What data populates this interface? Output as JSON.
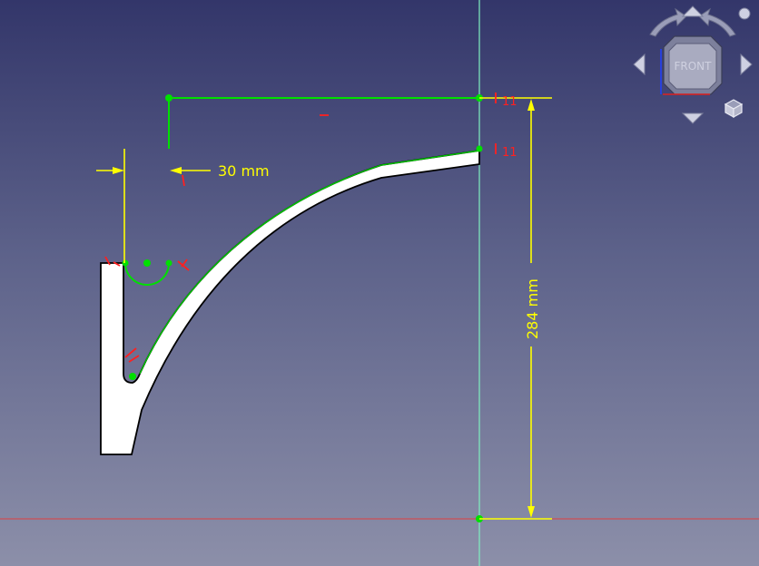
{
  "view": {
    "name": "Sketch 3D view",
    "colors": {
      "background_top": "#33366a",
      "background_bottom": "#8c8fa9",
      "constraint_green": "#00e000",
      "dimension_yellow": "#ffff00",
      "constraint_red": "#ff2020",
      "axis_vertical": "#7ff0c0",
      "axis_horizontal": "#e04040"
    }
  },
  "sketch": {
    "dimension_horizontal": "30 mm",
    "dimension_vertical": "284 mm",
    "constraint_top_label": "11",
    "constraint_mid_label": "11"
  },
  "navigation_cube": {
    "face_label": "FRONT",
    "icons": [
      "rotate-left-icon",
      "rotate-right-icon",
      "arrow-up-icon",
      "arrow-down-icon",
      "arrow-left-icon",
      "arrow-right-icon",
      "view-menu-icon",
      "iso-cube-icon"
    ]
  }
}
